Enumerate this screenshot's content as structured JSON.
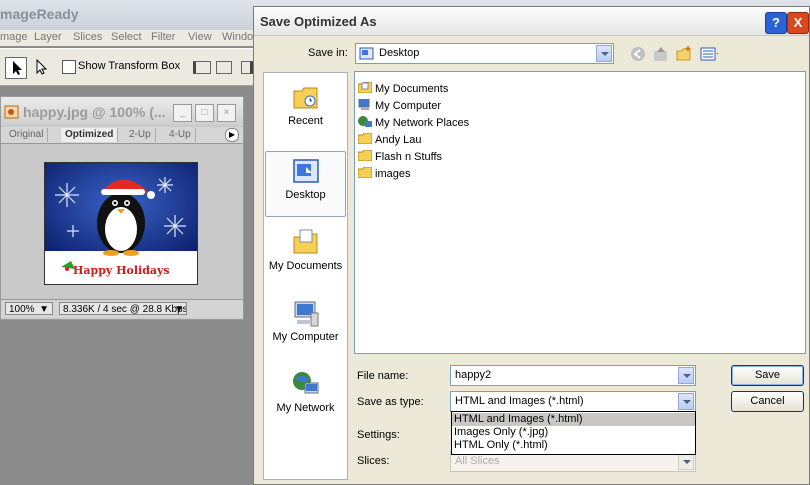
{
  "app": {
    "title": "mageReady",
    "menu": [
      "mage",
      "Layer",
      "Slices",
      "Select",
      "Filter",
      "View",
      "Windo"
    ],
    "show_transform_box": "Show Transform Box"
  },
  "document": {
    "title": "happy.jpg @ 100% (...",
    "tabs": [
      "Original",
      "Optimized",
      "2-Up",
      "4-Up"
    ],
    "selected_tab": "Optimized",
    "zoom": "100%",
    "status": "8.336K / 4 sec @ 28.8 Kbps",
    "image_caption": "Happy Holidays"
  },
  "dialog": {
    "title": "Save Optimized As",
    "save_in_label": "Save in:",
    "save_in_value": "Desktop",
    "places": [
      "Recent",
      "Desktop",
      "My Documents",
      "My Computer",
      "My Network"
    ],
    "selected_place": "Desktop",
    "files": [
      {
        "name": "My Documents",
        "icon": "my-documents-icon"
      },
      {
        "name": "My Computer",
        "icon": "computer-icon"
      },
      {
        "name": "My Network Places",
        "icon": "network-icon"
      },
      {
        "name": "Andy Lau",
        "icon": "folder-icon"
      },
      {
        "name": "Flash n Stuffs",
        "icon": "folder-icon"
      },
      {
        "name": "images",
        "icon": "folder-icon"
      }
    ],
    "file_name_label": "File name:",
    "file_name_value": "happy2",
    "save_as_type_label": "Save as type:",
    "save_as_type_value": "HTML and Images (*.html)",
    "type_options": [
      "HTML and Images (*.html)",
      "Images Only (*.jpg)",
      "HTML Only (*.html)"
    ],
    "settings_label": "Settings:",
    "slices_label": "Slices:",
    "slices_value": "All Slices",
    "save_button": "Save",
    "cancel_button": "Cancel",
    "help_button": "?",
    "close_button": "X"
  },
  "colors": {
    "dialog_bg": "#ece9d8",
    "help_btn": "#2b62d6",
    "close_btn": "#d9471f",
    "selection_gray": "#c9c7c3"
  }
}
